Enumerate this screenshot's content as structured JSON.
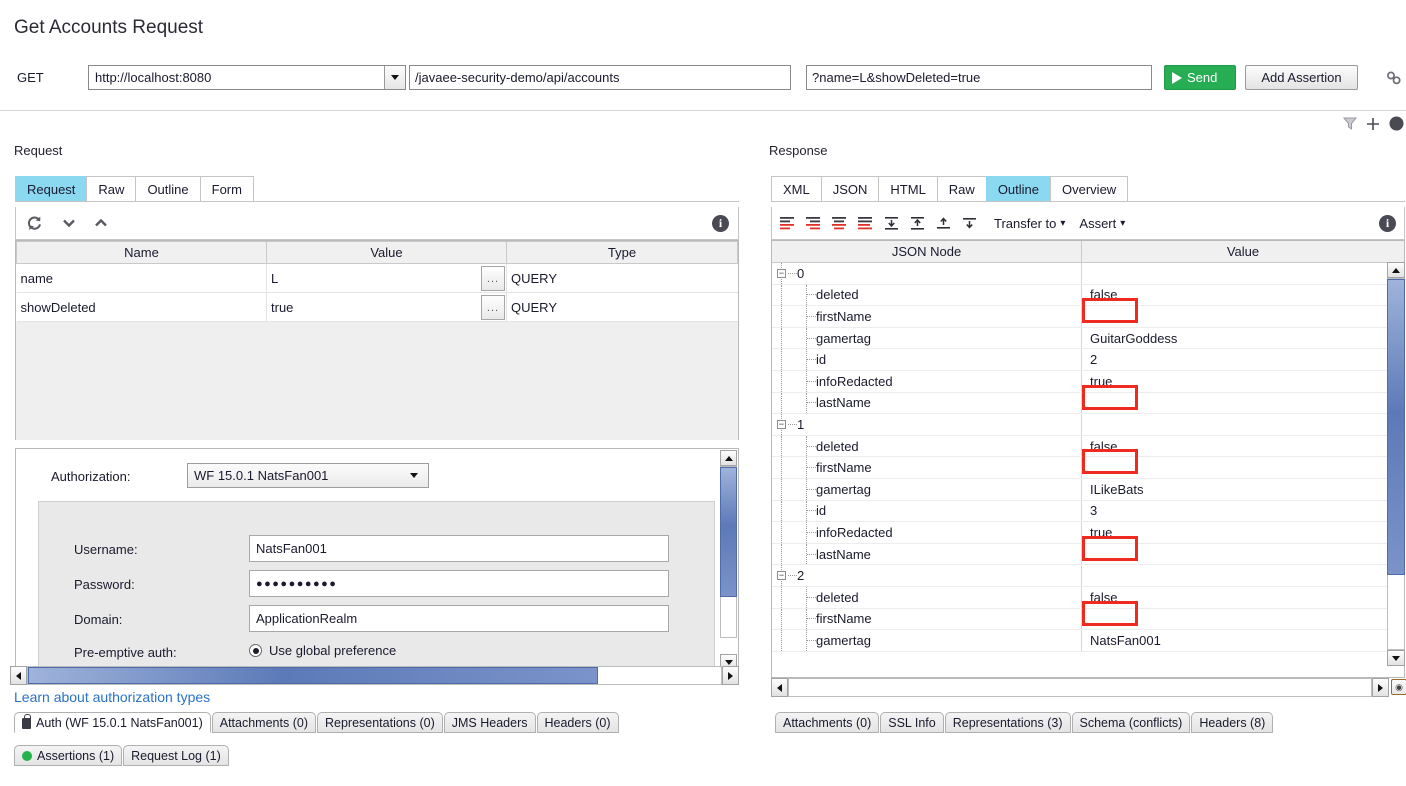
{
  "page_title": "Get Accounts Request",
  "request_bar": {
    "method": "GET",
    "endpoint": "http://localhost:8080",
    "resource_path": "/javaee-security-demo/api/accounts",
    "query_string": "?name=L&showDeleted=true",
    "send_label": "Send",
    "add_assertion_label": "Add Assertion",
    "chain_icon": "link-icon",
    "filter_icon": "filter-icon",
    "plus_icon": "plus-icon",
    "circle_icon": "circle-icon"
  },
  "request_panel": {
    "caption": "Request",
    "tabs": [
      {
        "label": "Request",
        "active": true
      },
      {
        "label": "Raw",
        "active": false
      },
      {
        "label": "Outline",
        "active": false
      },
      {
        "label": "Form",
        "active": false
      }
    ],
    "toolbar": {
      "refresh_icon": "refresh-icon",
      "move_down_icon": "chevron-down-icon",
      "move_up_icon": "chevron-up-icon",
      "info_icon": "info-icon",
      "info_glyph": "i"
    },
    "params_table": {
      "columns": [
        "Name",
        "Value",
        "Type"
      ],
      "rows": [
        {
          "name": "name",
          "value": "L",
          "type": "QUERY",
          "editor_label": "..."
        },
        {
          "name": "showDeleted",
          "value": "true",
          "type": "QUERY",
          "editor_label": "..."
        }
      ]
    },
    "auth": {
      "authorization_label": "Authorization:",
      "authorization_value": "WF 15.0.1 NatsFan001",
      "username_label": "Username:",
      "username_value": "NatsFan001",
      "password_label": "Password:",
      "password_value": "●●●●●●●●●●",
      "domain_label": "Domain:",
      "domain_value": "ApplicationRealm",
      "preemptive_label": "Pre-emptive auth:",
      "preemptive_option": "Use global preference"
    },
    "learn_link": "Learn about authorization types",
    "bottom_tabs_row1": [
      {
        "label": "Auth (WF 15.0.1 NatsFan001)",
        "selected": true,
        "icon": "lock-icon"
      },
      {
        "label": "Attachments (0)",
        "selected": false,
        "icon": ""
      },
      {
        "label": "Representations (0)",
        "selected": false,
        "icon": ""
      },
      {
        "label": "JMS Headers",
        "selected": false,
        "icon": ""
      },
      {
        "label": "Headers (0)",
        "selected": false,
        "icon": ""
      }
    ],
    "bottom_tabs_row2": [
      {
        "label": "Assertions (1)",
        "selected": false,
        "icon": "green-dot-icon"
      },
      {
        "label": "Request Log (1)",
        "selected": false,
        "icon": ""
      }
    ]
  },
  "response_panel": {
    "caption": "Response",
    "tabs": [
      {
        "label": "XML",
        "active": false
      },
      {
        "label": "JSON",
        "active": false
      },
      {
        "label": "HTML",
        "active": false
      },
      {
        "label": "Raw",
        "active": false
      },
      {
        "label": "Outline",
        "active": true
      },
      {
        "label": "Overview",
        "active": false
      }
    ],
    "toolbar": {
      "align_icons": [
        "align-left-icon",
        "align-right-icon",
        "align-center-icon",
        "align-justify-icon",
        "expand-all-icon",
        "collapse-all-icon",
        "collapse-node-icon",
        "expand-node-icon"
      ],
      "transfer_to_label": "Transfer to",
      "assert_label": "Assert",
      "info_icon": "info-icon",
      "info_glyph": "i"
    },
    "outline": {
      "columns": [
        "JSON Node",
        "Value"
      ],
      "rows": [
        {
          "node": "0",
          "value": "",
          "level": 0,
          "expandable": true,
          "highlight": false
        },
        {
          "node": "deleted",
          "value": "false",
          "level": 1,
          "expandable": false,
          "highlight": false
        },
        {
          "node": "firstName",
          "value": "",
          "level": 1,
          "expandable": false,
          "highlight": true
        },
        {
          "node": "gamertag",
          "value": "GuitarGoddess",
          "level": 1,
          "expandable": false,
          "highlight": false
        },
        {
          "node": "id",
          "value": "2",
          "level": 1,
          "expandable": false,
          "highlight": false
        },
        {
          "node": "infoRedacted",
          "value": "true",
          "level": 1,
          "expandable": false,
          "highlight": false
        },
        {
          "node": "lastName",
          "value": "",
          "level": 1,
          "expandable": false,
          "highlight": true
        },
        {
          "node": "1",
          "value": "",
          "level": 0,
          "expandable": true,
          "highlight": false
        },
        {
          "node": "deleted",
          "value": "false",
          "level": 1,
          "expandable": false,
          "highlight": false
        },
        {
          "node": "firstName",
          "value": "",
          "level": 1,
          "expandable": false,
          "highlight": true
        },
        {
          "node": "gamertag",
          "value": "ILikeBats",
          "level": 1,
          "expandable": false,
          "highlight": false
        },
        {
          "node": "id",
          "value": "3",
          "level": 1,
          "expandable": false,
          "highlight": false
        },
        {
          "node": "infoRedacted",
          "value": "true",
          "level": 1,
          "expandable": false,
          "highlight": false
        },
        {
          "node": "lastName",
          "value": "",
          "level": 1,
          "expandable": false,
          "highlight": true
        },
        {
          "node": "2",
          "value": "",
          "level": 0,
          "expandable": true,
          "highlight": false
        },
        {
          "node": "deleted",
          "value": "false",
          "level": 1,
          "expandable": false,
          "highlight": false
        },
        {
          "node": "firstName",
          "value": "",
          "level": 1,
          "expandable": false,
          "highlight": true
        },
        {
          "node": "gamertag",
          "value": "NatsFan001",
          "level": 1,
          "expandable": false,
          "highlight": false
        }
      ]
    },
    "bottom_tabs": [
      {
        "label": "Attachments (0)",
        "selected": false
      },
      {
        "label": "SSL Info",
        "selected": false
      },
      {
        "label": "Representations (3)",
        "selected": false
      },
      {
        "label": "Schema (conflicts)",
        "selected": false
      },
      {
        "label": "Headers (8)",
        "selected": false
      }
    ]
  },
  "colors": {
    "active_tab": "#8ad9f0",
    "send_green": "#27ae54",
    "link_blue": "#2a72c8",
    "highlight_red": "#ef2a21",
    "scrollbar_blue": "#5c7ab8",
    "status_green": "#24b34b"
  }
}
